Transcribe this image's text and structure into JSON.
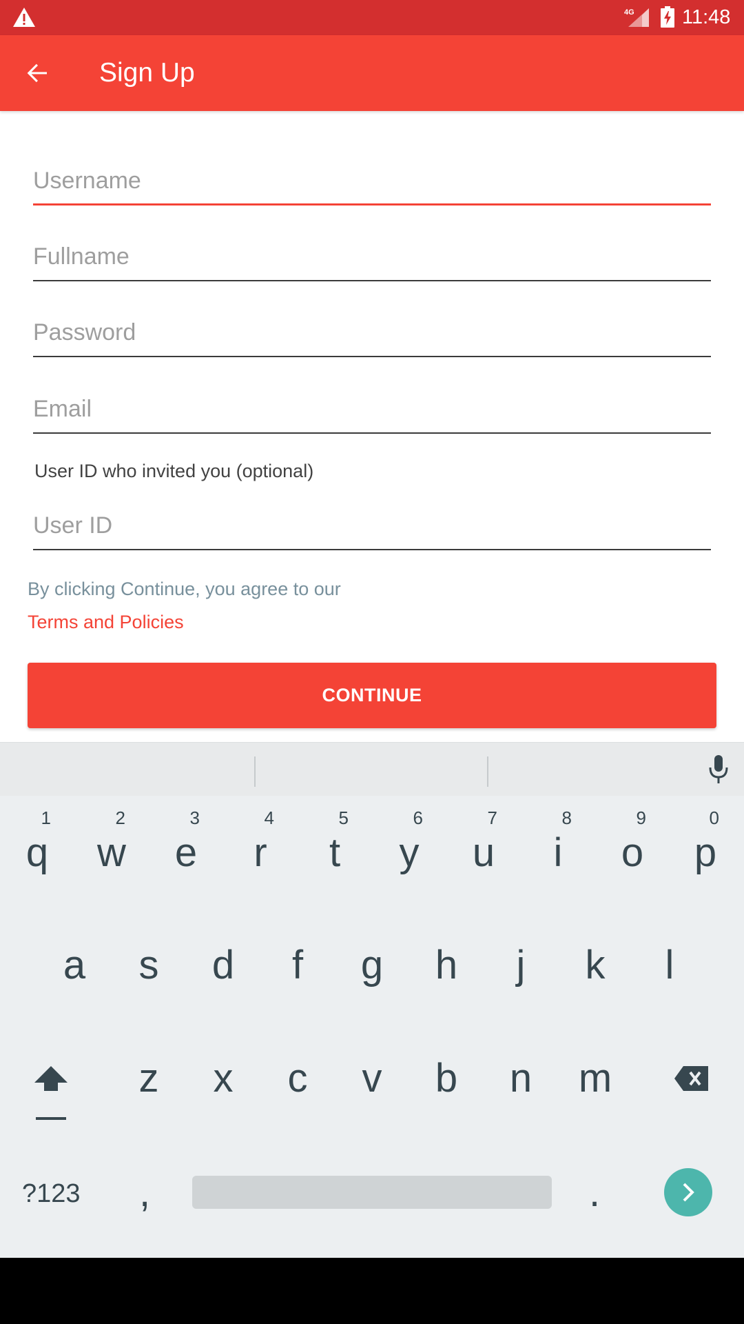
{
  "status_bar": {
    "network": "4G",
    "time": "11:48",
    "icons": [
      "warning-icon",
      "signal-icon",
      "battery-charging-icon"
    ]
  },
  "app_bar": {
    "title": "Sign Up",
    "back_icon": "back-arrow-icon"
  },
  "form": {
    "username": {
      "value": "",
      "placeholder": "Username"
    },
    "fullname": {
      "value": "",
      "placeholder": "Fullname"
    },
    "password": {
      "value": "",
      "placeholder": "Password"
    },
    "email": {
      "value": "",
      "placeholder": "Email"
    },
    "invite_label": "User ID who invited you (optional)",
    "user_id": {
      "value": "",
      "placeholder": "User ID"
    },
    "agree_text": "By clicking Continue, you agree to our",
    "terms_link": "Terms and Policies",
    "continue_label": "CONTINUE"
  },
  "keyboard": {
    "row1": [
      {
        "ch": "q",
        "num": "1"
      },
      {
        "ch": "w",
        "num": "2"
      },
      {
        "ch": "e",
        "num": "3"
      },
      {
        "ch": "r",
        "num": "4"
      },
      {
        "ch": "t",
        "num": "5"
      },
      {
        "ch": "y",
        "num": "6"
      },
      {
        "ch": "u",
        "num": "7"
      },
      {
        "ch": "i",
        "num": "8"
      },
      {
        "ch": "o",
        "num": "9"
      },
      {
        "ch": "p",
        "num": "0"
      }
    ],
    "row2": [
      "a",
      "s",
      "d",
      "f",
      "g",
      "h",
      "j",
      "k",
      "l"
    ],
    "row3": [
      "z",
      "x",
      "c",
      "v",
      "b",
      "n",
      "m"
    ],
    "symbols_label": "?123",
    "comma": ",",
    "period": "."
  },
  "colors": {
    "status_bar": "#d32f2f",
    "primary": "#f44336",
    "link": "#f44336",
    "enter_key": "#4db6ac"
  }
}
